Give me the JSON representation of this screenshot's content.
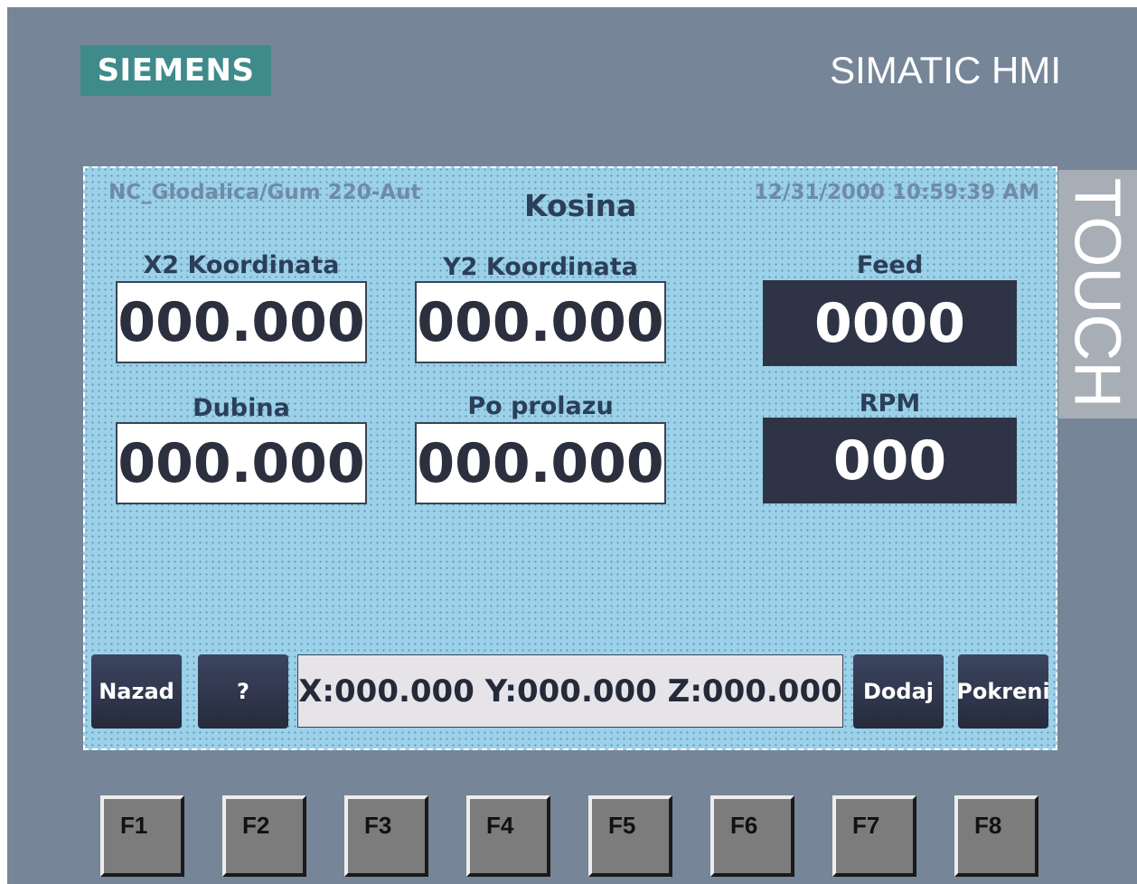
{
  "brand": {
    "logo": "SIEMENS",
    "product": "SIMATIC HMI",
    "side_label": "TOUCH",
    "logo_color": "#3f8a8a"
  },
  "screen": {
    "project": "NC_Glodalica/Gum 220-Aut",
    "title": "Kosina",
    "datetime": "12/31/2000 10:59:39 AM",
    "background_color": "#9bd1e9"
  },
  "fields": {
    "x2": {
      "label": "X2 Koordinata",
      "value": "000.000"
    },
    "y2": {
      "label": "Y2 Koordinata",
      "value": "000.000"
    },
    "dubina": {
      "label": "Dubina",
      "value": "000.000"
    },
    "po_prolazu": {
      "label": "Po prolazu",
      "value": "000.000"
    },
    "feed": {
      "label": "Feed",
      "value": "0000"
    },
    "rpm": {
      "label": "RPM",
      "value": "000"
    }
  },
  "toolbar": {
    "back_label": "Nazad",
    "help_label": "?",
    "coordinates": "X:000.000 Y:000.000 Z:000.000",
    "add_label": "Dodaj",
    "start_label": "Pokreni"
  },
  "function_keys": [
    "F1",
    "F2",
    "F3",
    "F4",
    "F5",
    "F6",
    "F7",
    "F8"
  ]
}
